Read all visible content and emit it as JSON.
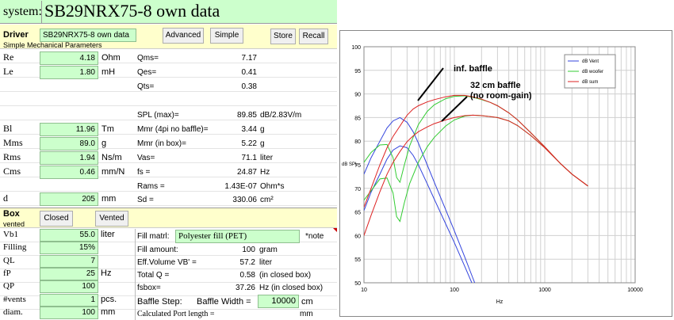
{
  "system": {
    "label": "system:",
    "title": "SB29NRX75-8 own data"
  },
  "driver": {
    "label": "Driver",
    "name": "SB29NRX75-8 own data",
    "buttons": {
      "advanced": "Advanced",
      "simple": "Simple",
      "store": "Store",
      "recall": "Recall"
    },
    "subtitle": "Simple Mechanical Parameters"
  },
  "params_left": [
    {
      "sym": "Re",
      "value": "4.18",
      "unit": "Ohm"
    },
    {
      "sym": "Le",
      "value": "1.80",
      "unit": "mH"
    },
    {
      "sym": "Bl",
      "value": "11.96",
      "unit": "Tm"
    },
    {
      "sym": "Mms",
      "value": "89.0",
      "unit": "g"
    },
    {
      "sym": "Rms",
      "value": "1.94",
      "unit": "Ns/m"
    },
    {
      "sym": "Cms",
      "value": "0.46",
      "unit": "mm/N"
    },
    {
      "sym": "d",
      "value": "205",
      "unit": "mm"
    }
  ],
  "params_right": [
    {
      "label": "Qms=",
      "value": "7.17",
      "unit": ""
    },
    {
      "label": "Qes=",
      "value": "0.41",
      "unit": ""
    },
    {
      "label": "Qts=",
      "value": "0.38",
      "unit": ""
    },
    {
      "label": "SPL (max)=",
      "value": "89.85",
      "unit": "dB/2.83V/m"
    },
    {
      "label": "Mmr (4pi no baffle)=",
      "value": "3.44",
      "unit": "g"
    },
    {
      "label": "Mmr (in box)=",
      "value": "5.22",
      "unit": "g"
    },
    {
      "label": "Vas=",
      "value": "71.1",
      "unit": "liter"
    },
    {
      "label": "fs =",
      "value": "24.87",
      "unit": "Hz"
    },
    {
      "label": "Rams =",
      "value": "1.43E-07",
      "unit": "Ohm*s"
    },
    {
      "label": "Sd =",
      "value": "330.06",
      "unit": "cm²"
    }
  ],
  "box": {
    "label": "Box",
    "sublabel": "vented",
    "buttons": {
      "closed": "Closed",
      "vented": "Vented"
    },
    "rows": [
      {
        "sym": "Vb1",
        "value": "55.0",
        "unit": "liter"
      },
      {
        "sym": "Filling",
        "value": "15%",
        "unit": ""
      },
      {
        "sym": "QL",
        "value": "7",
        "unit": ""
      },
      {
        "sym": "fP",
        "value": "25",
        "unit": "Hz"
      },
      {
        "sym": "QP",
        "value": "100",
        "unit": ""
      },
      {
        "sym": "#vents",
        "value": "1",
        "unit": "pcs."
      },
      {
        "sym": "diam.",
        "value": "100",
        "unit": "mm"
      }
    ],
    "fill_matrl_label": "Fill matrl:",
    "fill_matrl_value": "Polyester fill (PET)",
    "note": "*note",
    "fill_amount_label": "Fill amount:",
    "fill_amount_value": "100",
    "fill_amount_unit": "gram",
    "eff_volume_label": "Eff.Volume VB' =",
    "eff_volume_value": "57.2",
    "eff_volume_unit": "liter",
    "total_q_label": "Total Q =",
    "total_q_value": "0.58",
    "total_q_unit": "(in closed box)",
    "fs_box_label": "fsbox=",
    "fs_box_value": "37.26",
    "fs_box_unit": "Hz  (in closed box)",
    "baffle_step_label": "Baffle Step:",
    "baffle_width_label": "Baffle Width  =",
    "baffle_width_value": "10000",
    "baffle_width_unit": "cm",
    "port_length_label": "Calculated Port length =",
    "port_length_unit": "mm"
  },
  "chart_data": {
    "type": "line",
    "xscale": "log",
    "xlim": [
      10,
      10000
    ],
    "ylim": [
      50,
      100
    ],
    "xlabel": "Hz",
    "ylabel": "dB SPL",
    "xticks": [
      "10",
      "100",
      "1000",
      "10000"
    ],
    "yticks": [
      "50",
      "55",
      "60",
      "65",
      "70",
      "75",
      "80",
      "85",
      "90",
      "95",
      "100"
    ],
    "legend_position": "top-right",
    "grid": true,
    "annotations": [
      "inf. baffle",
      "32 cm baffle",
      "(no room-gain)"
    ],
    "series": [
      {
        "name": "dB Vent",
        "color": "#3344dd",
        "x": [
          10,
          12,
          15,
          18,
          21,
          25,
          30,
          35,
          40,
          50,
          60,
          80,
          100,
          130,
          160,
          180,
          200
        ],
        "y_inf": [
          73,
          76.5,
          80,
          82.8,
          84.3,
          85,
          84,
          82,
          79.6,
          75,
          71.3,
          65.5,
          61,
          55.5,
          51,
          48.5,
          46.5
        ],
        "y_32": [
          65.3,
          69.2,
          73,
          76.2,
          78.1,
          79,
          78.6,
          77,
          75,
          71,
          67.7,
          62.5,
          58.5,
          53.5,
          49.5,
          47.5,
          45.5
        ]
      },
      {
        "name": "dB woofer",
        "color": "#33cc33",
        "x": [
          10,
          12,
          15,
          18,
          21,
          23,
          25,
          28,
          32,
          40,
          50,
          60,
          80,
          100,
          130,
          160,
          200,
          250,
          300,
          400,
          500,
          700,
          1000,
          1500,
          2000,
          3000
        ],
        "y_inf": [
          75.5,
          77.6,
          79.2,
          79.3,
          76.5,
          72.3,
          71.3,
          75,
          79,
          83.5,
          86.3,
          87.7,
          89,
          89.5,
          89.6,
          89.3,
          88.8,
          88.2,
          87.5,
          86,
          84.5,
          81.8,
          78.8,
          75.2,
          73,
          70.5
        ],
        "y_32": [
          67.5,
          69.5,
          72,
          72.2,
          69,
          64,
          63,
          67,
          71,
          75.5,
          78.8,
          80.8,
          83.2,
          84.5,
          85.3,
          85.5,
          85.4,
          85.2,
          85,
          84.3,
          83.3,
          81.2,
          78.6,
          75.2,
          73,
          70.5
        ]
      },
      {
        "name": "dB sum",
        "color": "#dd2222",
        "x": [
          10,
          12,
          15,
          18,
          21,
          25,
          30,
          35,
          40,
          50,
          60,
          80,
          100,
          130,
          160,
          200,
          250,
          300,
          400,
          500,
          700,
          1000,
          1500,
          2000,
          3000
        ],
        "y_inf": [
          66,
          70,
          75,
          78.6,
          81,
          83.2,
          85.5,
          86.8,
          87.5,
          88.3,
          88.8,
          89.4,
          89.7,
          89.7,
          89.4,
          88.9,
          88.2,
          87.5,
          86,
          84.5,
          81.8,
          78.8,
          75.2,
          73,
          70.5
        ],
        "y_32": [
          60,
          64.3,
          69.3,
          73,
          75.5,
          77.8,
          79.9,
          81.1,
          82,
          83,
          83.7,
          84.5,
          85,
          85.4,
          85.5,
          85.4,
          85.2,
          85,
          84.3,
          83.3,
          81.2,
          78.6,
          75.2,
          73,
          70.5
        ]
      }
    ]
  }
}
